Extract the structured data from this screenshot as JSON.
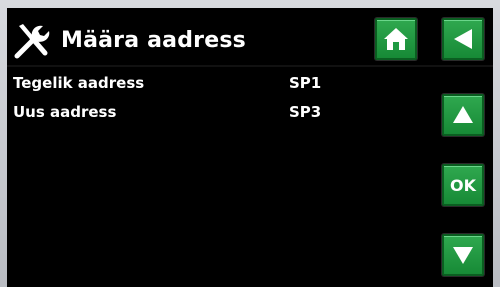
{
  "header": {
    "title": "Määra aadress",
    "icon": "tools-icon"
  },
  "rows": [
    {
      "label": "Tegelik aadress",
      "value": "SP1"
    },
    {
      "label": "Uus aadress",
      "value": "SP3"
    }
  ],
  "buttons": {
    "home_icon": "home-icon",
    "back_icon": "back-arrow-icon",
    "up_icon": "up-arrow-icon",
    "ok_label": "OK",
    "down_icon": "down-arrow-icon"
  },
  "colors": {
    "screen_bg": "#000000",
    "button_green": "#1f9a42",
    "text": "#ffffff"
  }
}
